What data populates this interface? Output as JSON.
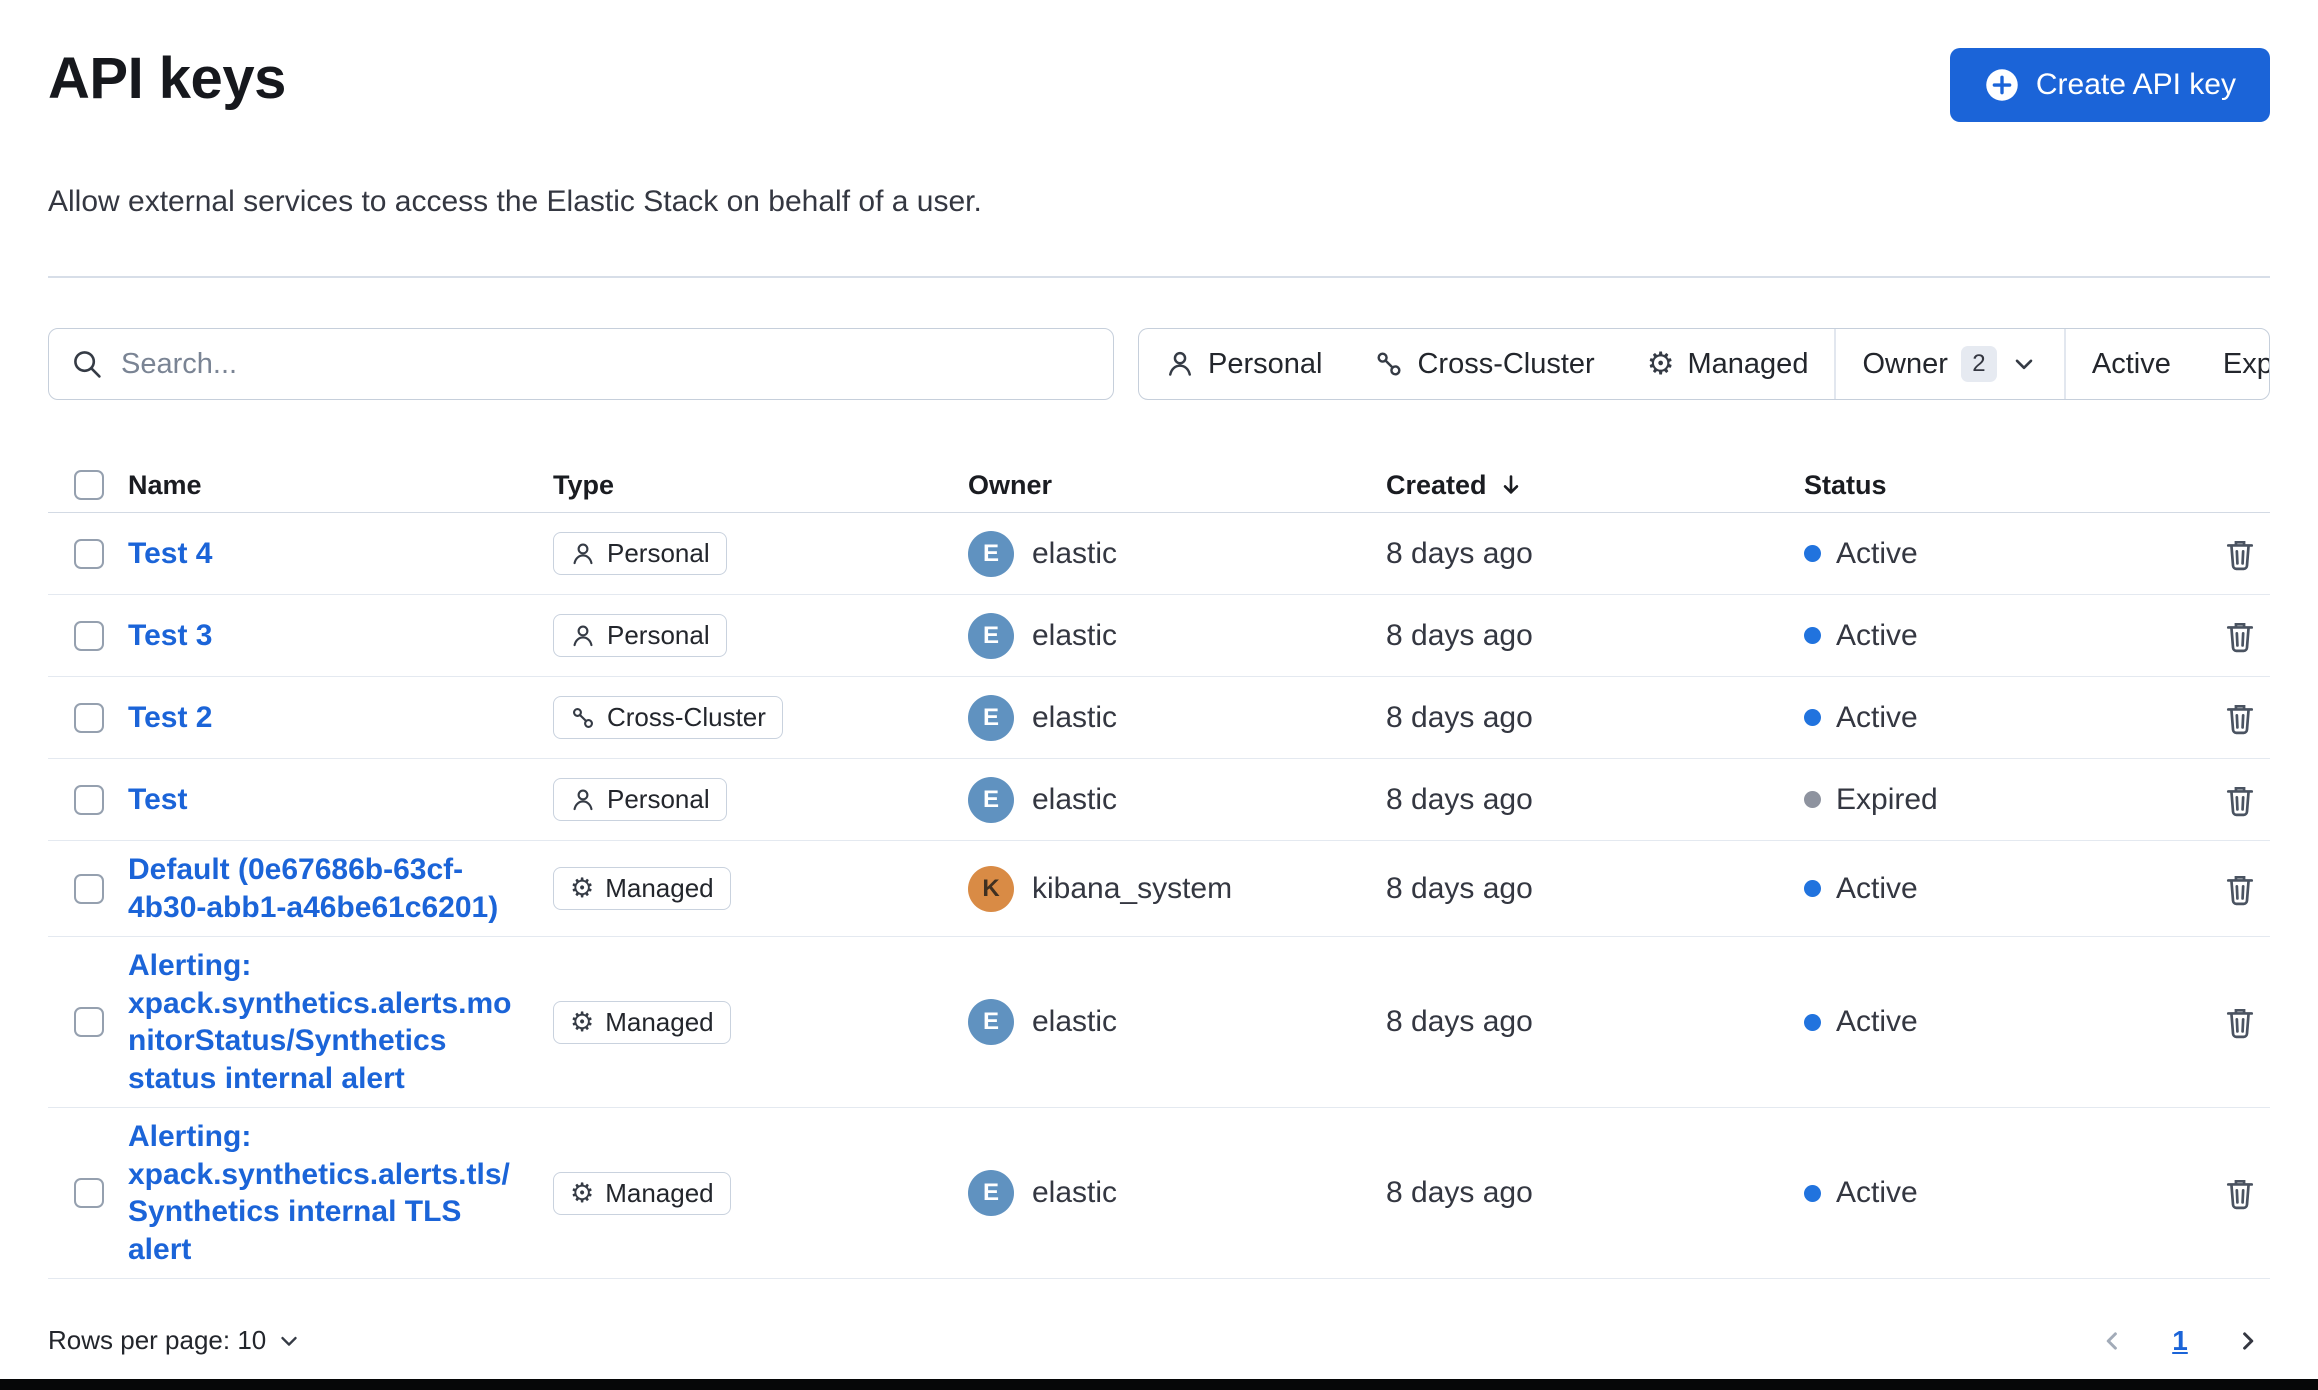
{
  "colors": {
    "primary": "#1B64D8",
    "link": "#1B64D8",
    "active_status": "#2173DE",
    "expired_status": "#8E939F"
  },
  "icons": {
    "gear": "⚙"
  },
  "header": {
    "title": "API keys",
    "subtitle": "Allow external services to access the Elastic Stack on behalf of a user.",
    "create_button": "Create API key"
  },
  "controls": {
    "search_placeholder": "Search...",
    "filters": {
      "personal": "Personal",
      "cross_cluster": "Cross-Cluster",
      "managed": "Managed",
      "owner": "Owner",
      "owner_count": "2",
      "active": "Active",
      "expired": "Expired"
    }
  },
  "table": {
    "columns": {
      "name": "Name",
      "type": "Type",
      "owner": "Owner",
      "created": "Created",
      "status": "Status"
    },
    "rows": [
      {
        "name": "Test 4",
        "type": "Personal",
        "type_icon": "person",
        "owner": "elastic",
        "avatar_letter": "E",
        "avatar_color": "#6092C0",
        "avatar_text_color": "#FFFFFF",
        "created": "8 days ago",
        "status": "Active",
        "status_color": "#2173DE"
      },
      {
        "name": "Test 3",
        "type": "Personal",
        "type_icon": "person",
        "owner": "elastic",
        "avatar_letter": "E",
        "avatar_color": "#6092C0",
        "avatar_text_color": "#FFFFFF",
        "created": "8 days ago",
        "status": "Active",
        "status_color": "#2173DE"
      },
      {
        "name": "Test 2",
        "type": "Cross-Cluster",
        "type_icon": "cluster",
        "owner": "elastic",
        "avatar_letter": "E",
        "avatar_color": "#6092C0",
        "avatar_text_color": "#FFFFFF",
        "created": "8 days ago",
        "status": "Active",
        "status_color": "#2173DE"
      },
      {
        "name": "Test",
        "type": "Personal",
        "type_icon": "person",
        "owner": "elastic",
        "avatar_letter": "E",
        "avatar_color": "#6092C0",
        "avatar_text_color": "#FFFFFF",
        "created": "8 days ago",
        "status": "Expired",
        "status_color": "#8E939F"
      },
      {
        "name": "Default (0e67686b-63cf-4b30-abb1-a46be61c6201)",
        "type": "Managed",
        "type_icon": "gear",
        "owner": "kibana_system",
        "avatar_letter": "K",
        "avatar_color": "#D98B45",
        "avatar_text_color": "#3F3021",
        "created": "8 days ago",
        "status": "Active",
        "status_color": "#2173DE"
      },
      {
        "name": "Alerting: xpack.synthetics.alerts.monitorStatus/Synthetics status internal alert",
        "type": "Managed",
        "type_icon": "gear",
        "owner": "elastic",
        "avatar_letter": "E",
        "avatar_color": "#6092C0",
        "avatar_text_color": "#FFFFFF",
        "created": "8 days ago",
        "status": "Active",
        "status_color": "#2173DE"
      },
      {
        "name": "Alerting: xpack.synthetics.alerts.tls/Synthetics internal TLS alert",
        "type": "Managed",
        "type_icon": "gear",
        "owner": "elastic",
        "avatar_letter": "E",
        "avatar_color": "#6092C0",
        "avatar_text_color": "#FFFFFF",
        "created": "8 days ago",
        "status": "Active",
        "status_color": "#2173DE"
      }
    ]
  },
  "footer": {
    "rows_per_page": "Rows per page: 10",
    "page": "1"
  }
}
